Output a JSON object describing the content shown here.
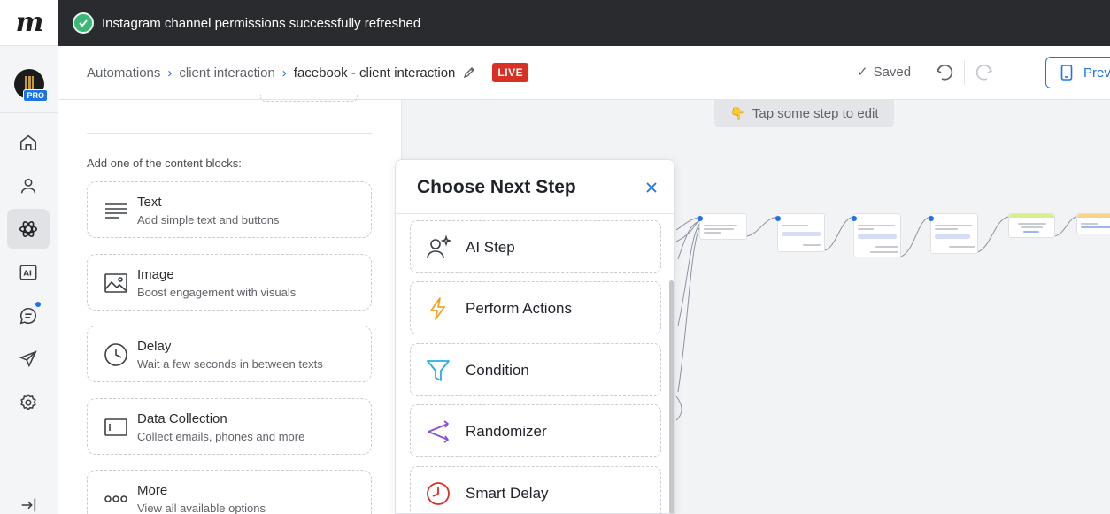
{
  "rail": {
    "logo": "m",
    "avatar_badge": "PRO",
    "items": [
      {
        "name": "home-icon",
        "active": false
      },
      {
        "name": "contacts-icon",
        "active": false
      },
      {
        "name": "automation-icon",
        "active": true
      },
      {
        "name": "ai-icon",
        "active": false
      },
      {
        "name": "chat-icon",
        "active": false
      },
      {
        "name": "broadcast-icon",
        "active": false
      },
      {
        "name": "settings-icon",
        "active": false
      }
    ],
    "collapse_icon": "collapse-icon"
  },
  "toast": {
    "message": "Instagram channel permissions successfully refreshed"
  },
  "header": {
    "breadcrumb": [
      "Automations",
      "client interaction",
      "facebook - client interaction"
    ],
    "live_label": "LIVE",
    "saved_label": "Saved",
    "preview_label": "Prev"
  },
  "panel": {
    "caption": "Add one of the content blocks:",
    "blocks": [
      {
        "title": "Text",
        "subtitle": "Add simple text and buttons",
        "icon": "text-lines-icon"
      },
      {
        "title": "Image",
        "subtitle": "Boost engagement with visuals",
        "icon": "image-icon"
      },
      {
        "title": "Delay",
        "subtitle": "Wait a few seconds in between texts",
        "icon": "clock-icon"
      },
      {
        "title": "Data Collection",
        "subtitle": "Collect emails, phones and more",
        "icon": "input-field-icon"
      },
      {
        "title": "More",
        "subtitle": "View all available options",
        "icon": "more-dots-icon"
      }
    ]
  },
  "canvas": {
    "hint": "Tap some step to edit",
    "hint_icon": "👇"
  },
  "modal": {
    "title": "Choose Next Step",
    "steps": [
      {
        "label": "AI Step",
        "icon": "ai-step-icon"
      },
      {
        "label": "Perform Actions",
        "icon": "lightning-icon"
      },
      {
        "label": "Condition",
        "icon": "filter-icon"
      },
      {
        "label": "Randomizer",
        "icon": "randomizer-icon"
      },
      {
        "label": "Smart Delay",
        "icon": "smart-delay-icon"
      }
    ]
  },
  "colors": {
    "accent": "#1b73e8",
    "live": "#d93025",
    "success": "#3bb878",
    "lightning": "#f4a21d",
    "condition": "#27aee0",
    "randomizer": "#8b4fd6",
    "smart_delay": "#d93025"
  }
}
